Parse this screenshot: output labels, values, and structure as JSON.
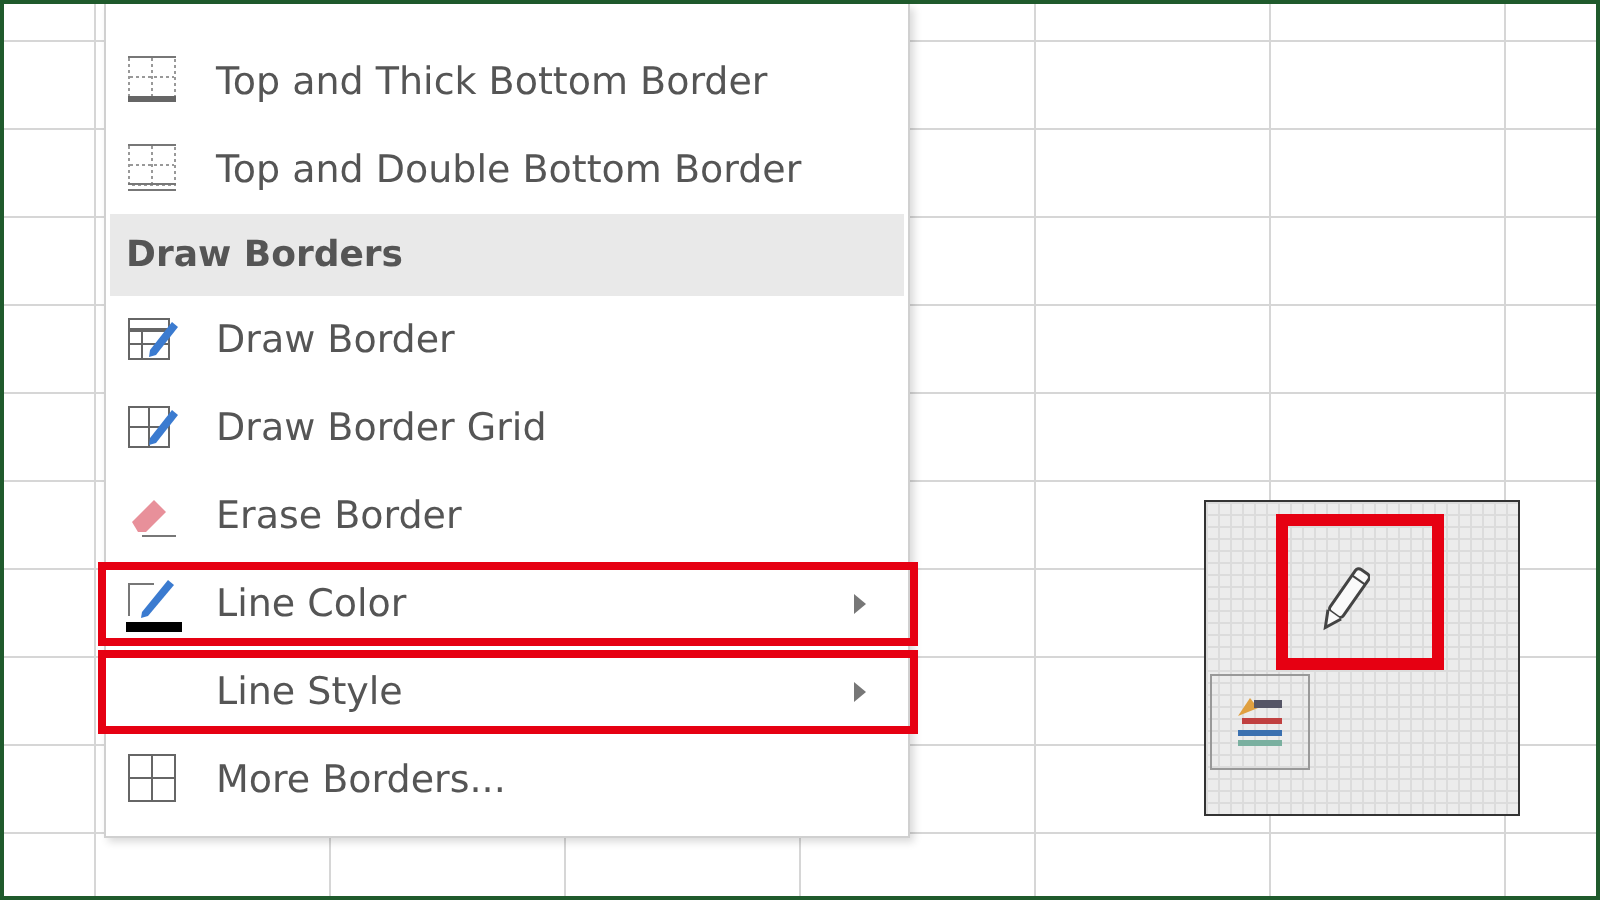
{
  "menu": {
    "items": [
      {
        "kind": "item",
        "label": "Top and Thick Bottom Border",
        "submenu": false,
        "highlighted": false
      },
      {
        "kind": "item",
        "label": "Top and Double Bottom Border",
        "submenu": false,
        "highlighted": false
      },
      {
        "kind": "header",
        "label": "Draw Borders"
      },
      {
        "kind": "item",
        "label": "Draw Border",
        "submenu": false,
        "highlighted": false
      },
      {
        "kind": "item",
        "label": "Draw Border Grid",
        "submenu": false,
        "highlighted": false
      },
      {
        "kind": "item",
        "label": "Erase Border",
        "submenu": false,
        "highlighted": false
      },
      {
        "kind": "item",
        "label": "Line Color",
        "submenu": true,
        "highlighted": true
      },
      {
        "kind": "item",
        "label": "Line Style",
        "submenu": true,
        "highlighted": true
      },
      {
        "kind": "item",
        "label": "More Borders...",
        "submenu": false,
        "highlighted": false
      }
    ]
  },
  "inset": {
    "cursor_highlighted": true
  }
}
